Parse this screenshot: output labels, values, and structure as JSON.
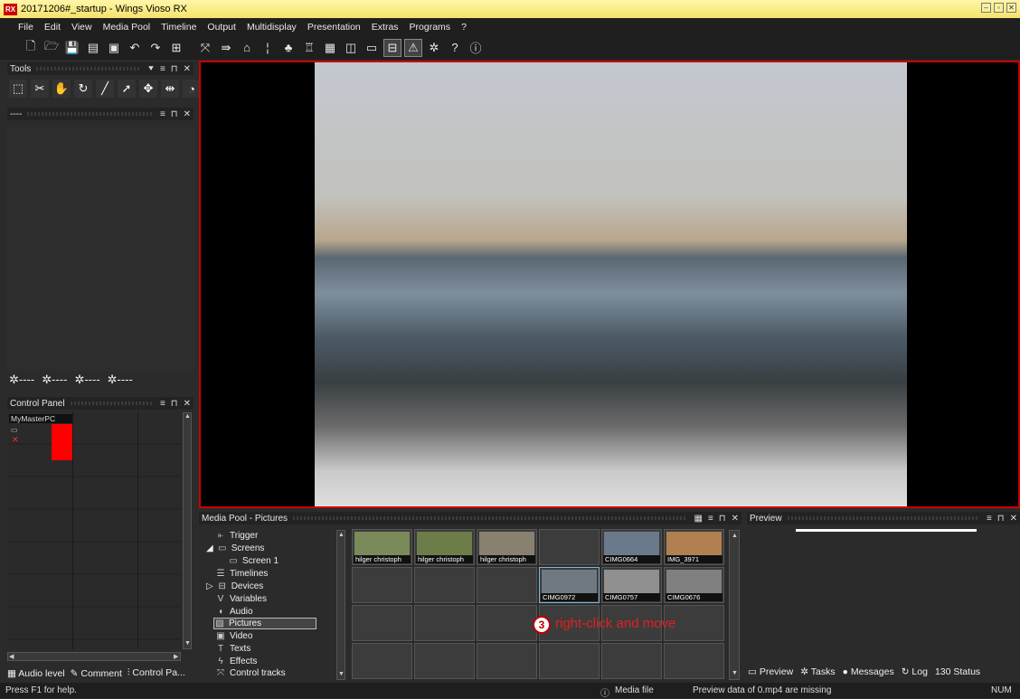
{
  "window": {
    "app_icon": "RX",
    "title": "20171206#_startup - Wings Vioso RX",
    "controls": [
      "minimize",
      "restore",
      "close"
    ]
  },
  "menu": [
    "File",
    "Edit",
    "View",
    "Media Pool",
    "Timeline",
    "Output",
    "Multidisplay",
    "Presentation",
    "Extras",
    "Programs",
    "?"
  ],
  "toolbar_icons": [
    "new-file-icon",
    "open-folder-icon",
    "save-icon",
    "save-all-icon",
    "save-as-icon",
    "undo-icon",
    "redo-icon",
    "screen-icon",
    "transform-icon",
    "play-icon",
    "record-icon",
    "marker-icon",
    "network-icon",
    "device-icon",
    "calendar-icon",
    "display-icon",
    "monitor-icon",
    "output-icon",
    "warning-icon",
    "gear-icon",
    "help-icon",
    "info-icon"
  ],
  "tools_panel": {
    "title": "Tools",
    "icons": [
      "select-rect-icon",
      "cut-icon",
      "hand-icon",
      "rotate-icon",
      "line-icon",
      "cursor-plus-icon",
      "move-icon",
      "fit-icon",
      "curve-icon"
    ]
  },
  "second_panel": {
    "title": "----"
  },
  "gear_row": [
    "✲----",
    "✲----",
    "✲----",
    "✲----"
  ],
  "control_panel": {
    "title": "Control Panel",
    "computer": "MyMasterPC"
  },
  "left_tabs": [
    {
      "label": "Audio level",
      "icon": "audio-level-icon"
    },
    {
      "label": "Comment",
      "icon": "pen-icon"
    },
    {
      "label": "Control Pa...",
      "icon": "control-panel-icon"
    }
  ],
  "media_pool": {
    "title": "Media Pool - Pictures",
    "tree": [
      {
        "label": "Trigger",
        "icon": "trigger-icon",
        "indent": 1
      },
      {
        "label": "Screens",
        "icon": "screens-icon",
        "indent": 1,
        "expander": "◢"
      },
      {
        "label": "Screen 1",
        "icon": "screen-icon",
        "indent": 2
      },
      {
        "label": "Timelines",
        "icon": "timelines-icon",
        "indent": 1
      },
      {
        "label": "Devices",
        "icon": "devices-icon",
        "indent": 1,
        "expander": "▷"
      },
      {
        "label": "Variables",
        "icon": "variables-icon",
        "indent": 1
      },
      {
        "label": "Audio",
        "icon": "audio-icon",
        "indent": 1
      },
      {
        "label": "Pictures",
        "icon": "pictures-icon",
        "indent": 1,
        "selected": true
      },
      {
        "label": "Video",
        "icon": "video-icon",
        "indent": 1
      },
      {
        "label": "Texts",
        "icon": "texts-icon",
        "indent": 1
      },
      {
        "label": "Effects",
        "icon": "effects-icon",
        "indent": 1
      },
      {
        "label": "Control tracks",
        "icon": "control-tracks-icon",
        "indent": 1
      }
    ],
    "thumbnails": [
      {
        "caption": "hilger christoph",
        "color": "#7a8a5a"
      },
      {
        "caption": "hilger christoph",
        "color": "#6d7d4a"
      },
      {
        "caption": "hilger christoph",
        "color": "#8a8070"
      },
      {
        "caption": "",
        "color": ""
      },
      {
        "caption": "CIMG0664",
        "color": "#6a7a8a"
      },
      {
        "caption": "IMG_3971",
        "color": "#b08050"
      },
      {
        "caption": "",
        "color": ""
      },
      {
        "caption": "",
        "color": ""
      },
      {
        "caption": "",
        "color": ""
      },
      {
        "caption": "CIMG0972",
        "color": "#707880",
        "selected": true
      },
      {
        "caption": "CIMG0757",
        "color": "#909090"
      },
      {
        "caption": "CIMG0676",
        "color": "#808080"
      }
    ]
  },
  "annotation": {
    "number": "3",
    "text": "right-click and move"
  },
  "preview": {
    "title": "Preview"
  },
  "right_tabs": [
    {
      "label": "Preview",
      "icon": "preview-icon"
    },
    {
      "label": "Tasks",
      "icon": "tasks-icon"
    },
    {
      "label": "Messages",
      "icon": "messages-icon"
    },
    {
      "label": "Log",
      "icon": "log-icon"
    },
    {
      "label": "130 Status",
      "icon": ""
    }
  ],
  "status": {
    "help": "Press F1 for help.",
    "media": "Media file",
    "missing": "Preview data of 0.mp4 are missing",
    "num": "NUM"
  }
}
